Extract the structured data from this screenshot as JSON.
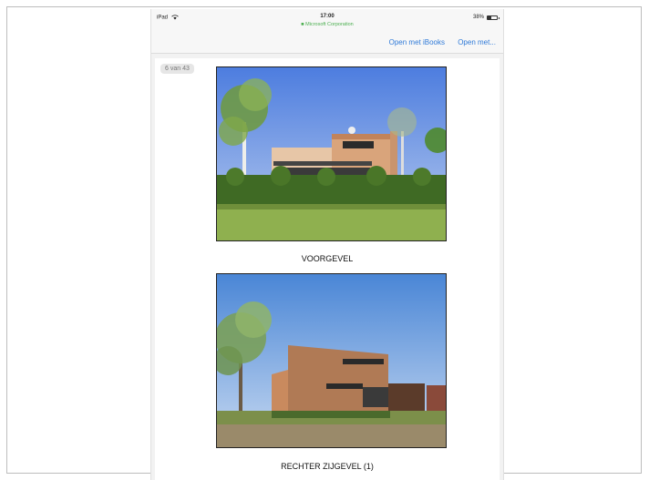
{
  "statusbar": {
    "device": "iPad",
    "time": "17:00",
    "carrier": "Microsoft Corporation",
    "battery": "38%",
    "battery_level": 0.38
  },
  "toolbar": {
    "open_ibooks": "Open met iBooks",
    "open_more": "Open met..."
  },
  "document": {
    "page_counter": "6 van 43",
    "photos": [
      {
        "caption": "VOORGEVEL"
      },
      {
        "caption": "RECHTER ZIJGEVEL (1)"
      }
    ]
  },
  "colors": {
    "link": "#2f7ad8",
    "carrier_green": "#4caf50"
  }
}
